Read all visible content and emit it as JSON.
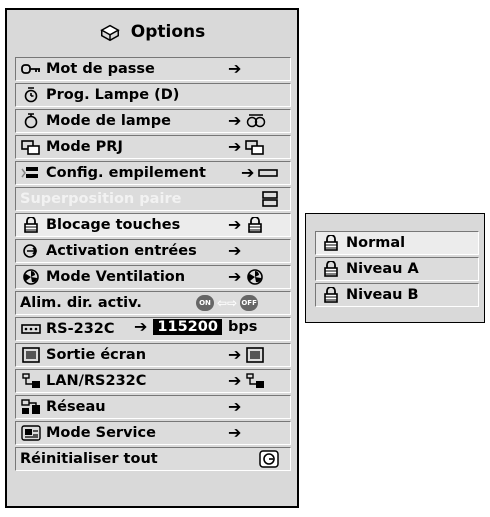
{
  "menu": {
    "title": "Options",
    "items": [
      {
        "label": "Mot de passe",
        "icon": "key-icon",
        "right_arrow": "➔",
        "right_icon": ""
      },
      {
        "label": "Prog. Lampe (D)",
        "icon": "lamp-timer-icon",
        "right_arrow": "",
        "right_icon": ""
      },
      {
        "label": "Mode de lampe",
        "icon": "lamp-icon",
        "right_arrow": "➔",
        "right_icon": "lamp-mode-icon"
      },
      {
        "label": "Mode PRJ",
        "icon": "projection-mode-icon",
        "right_arrow": "➔",
        "right_icon": "projection-mode-icon"
      },
      {
        "label": "Config. empilement",
        "icon": "stack-setup-icon",
        "right_arrow": "➔",
        "right_icon": "stack-box-icon"
      },
      {
        "label": "Superposition paire",
        "icon": "",
        "right_arrow": "",
        "right_icon": "stack-pair-icon",
        "disabled": true
      },
      {
        "label": "Blocage touches",
        "icon": "lock-icon",
        "right_arrow": "➔",
        "right_icon": "lock-icon",
        "selected": true
      },
      {
        "label": "Activation entrées",
        "icon": "input-activation-icon",
        "right_arrow": "➔",
        "right_icon": ""
      },
      {
        "label": "Mode Ventilation",
        "icon": "fan-icon",
        "right_arrow": "➔",
        "right_icon": "fan-icon"
      },
      {
        "label": "Alim. dir. activ.",
        "icon": "",
        "right_arrow": "",
        "right_icon": "on-off-icons"
      },
      {
        "label": "RS-232C",
        "icon": "rs232-icon",
        "right_arrow": "➔",
        "right_icon": "",
        "rate_value": "115200",
        "rate_unit": "bps"
      },
      {
        "label": "Sortie écran",
        "icon": "screen-output-icon",
        "right_arrow": "➔",
        "right_icon": "screen-output-icon"
      },
      {
        "label": "LAN/RS232C",
        "icon": "lan-icon",
        "right_arrow": "➔",
        "right_icon": "lan-icon"
      },
      {
        "label": "Réseau",
        "icon": "network-icon",
        "right_arrow": "➔",
        "right_icon": ""
      },
      {
        "label": "Mode Service",
        "icon": "service-icon",
        "right_arrow": "➔",
        "right_icon": ""
      },
      {
        "label": "Réinitialiser tout",
        "icon": "",
        "right_arrow": "",
        "right_icon": "reset-icon"
      }
    ]
  },
  "submenu": {
    "items": [
      "Normal",
      "Niveau A",
      "Niveau B"
    ]
  },
  "alim": {
    "on": "ON",
    "off": "OFF"
  }
}
